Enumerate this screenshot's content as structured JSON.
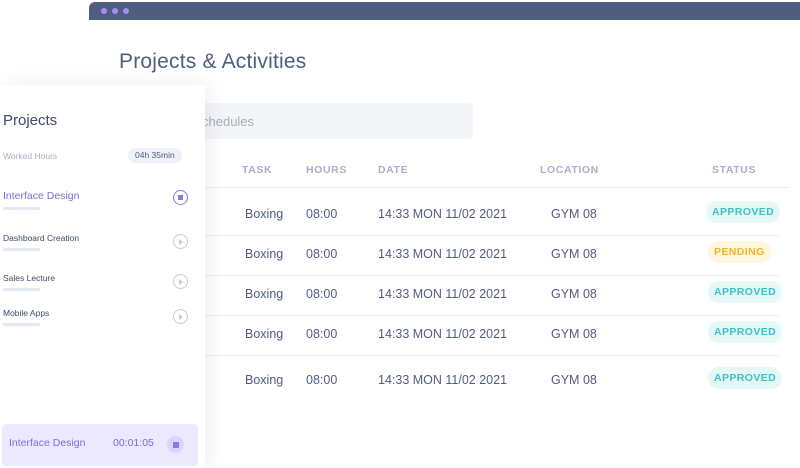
{
  "page": {
    "title": "Projects & Activities"
  },
  "search": {
    "placeholder": "chedules"
  },
  "table": {
    "columns": [
      "TASK",
      "HOURS",
      "DATE",
      "LOCATION",
      "STATUS"
    ],
    "rows": [
      {
        "task": "Boxing",
        "hours": "08:00",
        "date": "14:33 MON 11/02 2021",
        "location": "GYM 08",
        "status": "APPROVED"
      },
      {
        "task": "Boxing",
        "hours": "08:00",
        "date": "14:33 MON 11/02 2021",
        "location": "GYM 08",
        "status": "PENDING"
      },
      {
        "task": "Boxing",
        "hours": "08:00",
        "date": "14:33 MON 11/02 2021",
        "location": "GYM 08",
        "status": "APPROVED"
      },
      {
        "task": "Boxing",
        "hours": "08:00",
        "date": "14:33 MON 11/02 2021",
        "location": "GYM 08",
        "status": "APPROVED"
      },
      {
        "task": "Boxing",
        "hours": "08:00",
        "date": "14:33 MON 11/02 2021",
        "location": "GYM 08",
        "status": "APPROVED"
      }
    ]
  },
  "sidebar": {
    "title": "Projects",
    "worked_hours_label": "Worked Hours",
    "worked_hours_value": "04h 35min",
    "projects": [
      {
        "name": "Interface Design",
        "state": "active",
        "icon": "stop-icon"
      },
      {
        "name": "Dashboard Creation",
        "state": "idle",
        "icon": "play-icon"
      },
      {
        "name": "Sales Lecture",
        "state": "idle",
        "icon": "play-icon"
      },
      {
        "name": "Mobile Apps",
        "state": "idle",
        "icon": "play-icon"
      }
    ]
  },
  "timer": {
    "project": "Interface Design",
    "elapsed": "00:01:05",
    "icon": "stop-icon"
  },
  "colors": {
    "titlebar": "#4f5d7f",
    "accent": "#7e6bd9",
    "approved": "#3cc2c6",
    "pending": "#f0b32b"
  }
}
